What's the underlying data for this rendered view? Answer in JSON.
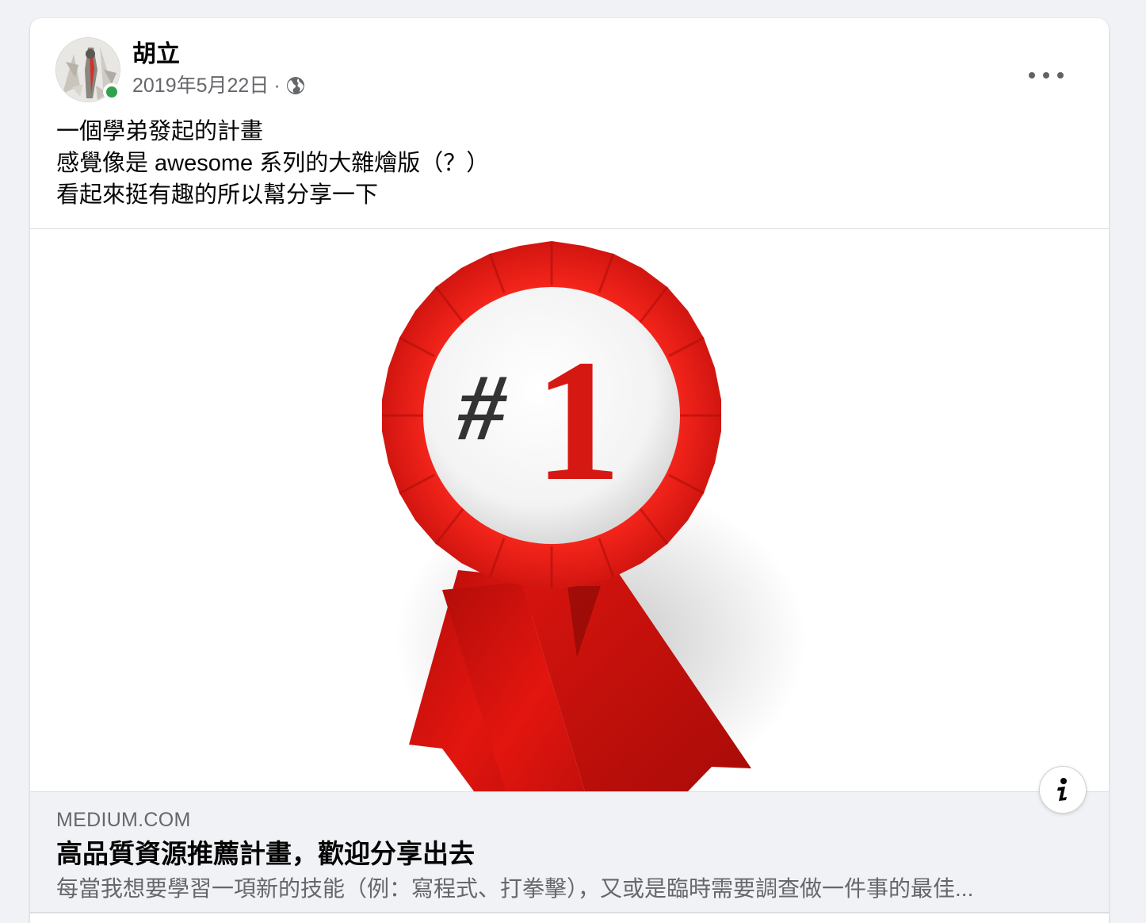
{
  "post": {
    "author": "胡立",
    "date": "2019年5月22日",
    "separator": "·",
    "privacy_icon": "globe-icon",
    "more_icon": "more-options-icon",
    "text_lines": [
      "一個學弟發起的計畫",
      "感覺像是 awesome 系列的大雜燴版（？）",
      "看起來挺有趣的所以幫分享一下"
    ],
    "author_online": true
  },
  "link_preview": {
    "image_icon": "first-place-ribbon-icon",
    "badge_text": "#1",
    "info_icon": "info-icon",
    "domain": "MEDIUM.COM",
    "title": "高品質資源推薦計畫，歡迎分享出去",
    "description": "每當我想要學習一項新的技能（例：寫程式、打拳擊），又或是臨時需要調查做一件事的最佳..."
  },
  "colors": {
    "background": "#f0f2f5",
    "card": "#ffffff",
    "online": "#31a24c",
    "secondary_text": "#65676b",
    "ribbon_red": "#e3150f"
  }
}
